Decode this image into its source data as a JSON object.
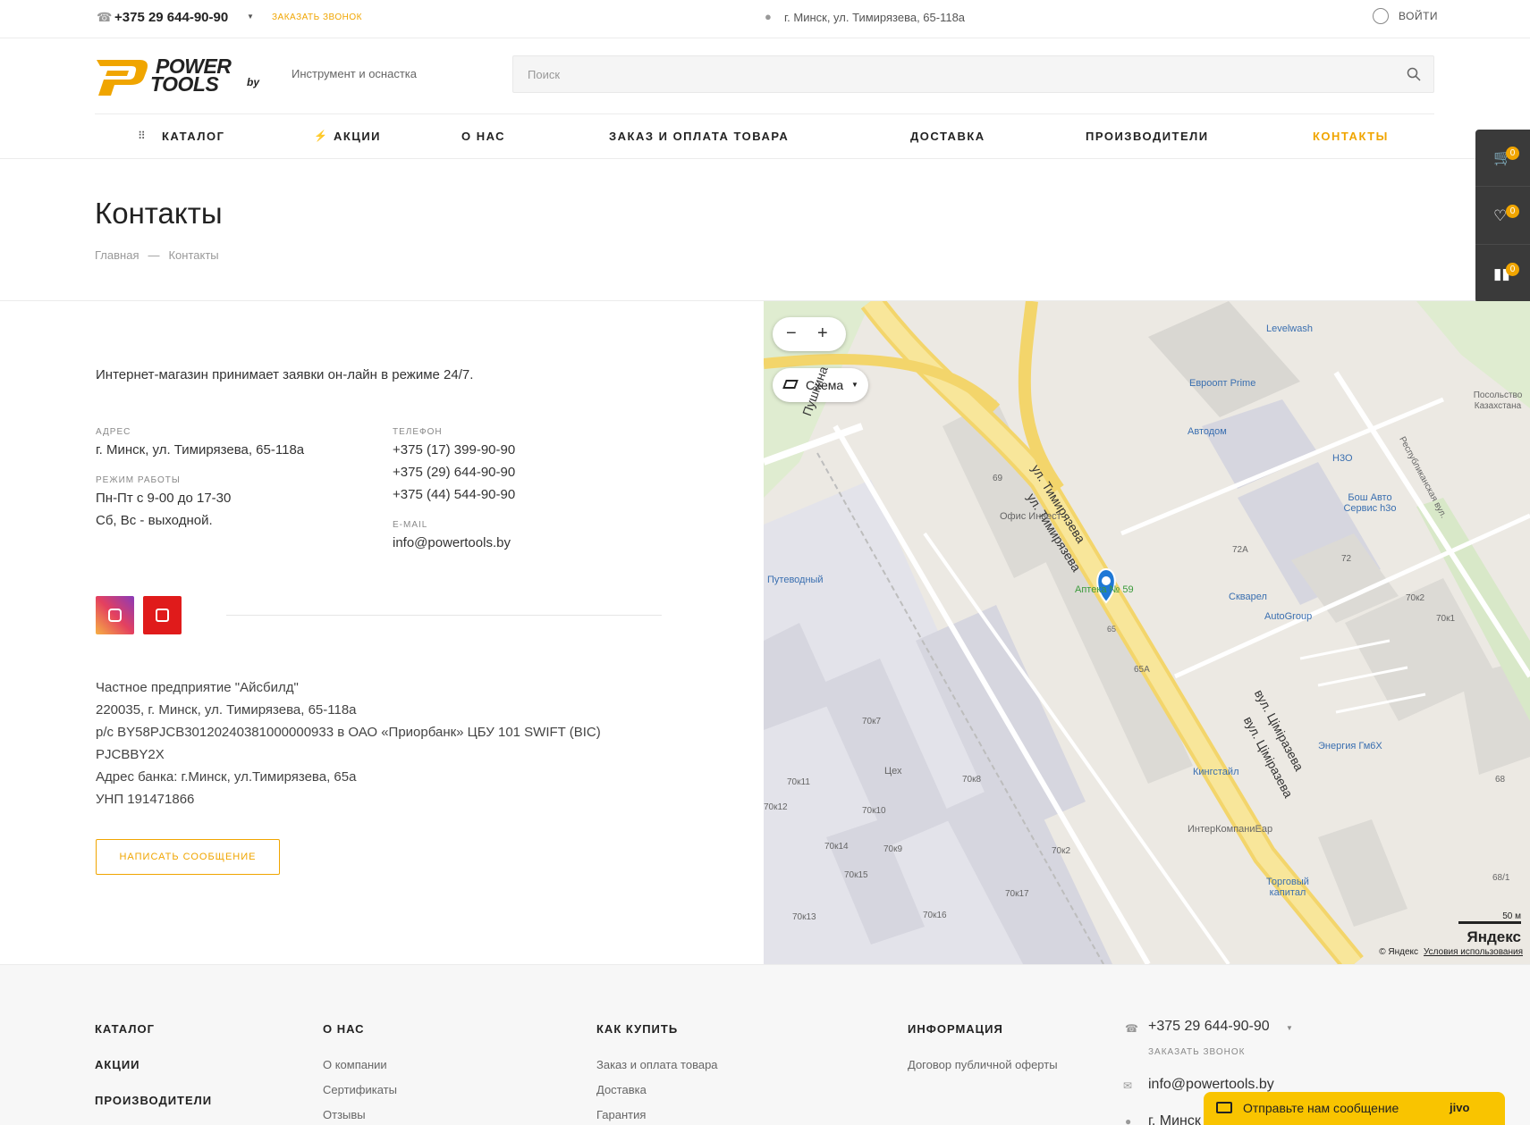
{
  "topbar": {
    "phone": "+375 29 644-90-90",
    "callback": "Заказать звонок",
    "address": "г. Минск, ул. Тимирязева, 65-118а",
    "login": "Войти"
  },
  "header": {
    "logo_text_1": "POWER",
    "logo_text_2": "TOOLS",
    "logo_suffix": "by",
    "tagline": "Инструмент и оснастка",
    "search_placeholder": "Поиск"
  },
  "nav": {
    "items": [
      {
        "label": "Каталог"
      },
      {
        "label": "Акции"
      },
      {
        "label": "О нас"
      },
      {
        "label": "Заказ и оплата товара"
      },
      {
        "label": "Доставка"
      },
      {
        "label": "Производители"
      },
      {
        "label": "Контакты"
      }
    ]
  },
  "page": {
    "title": "Контакты",
    "breadcrumb": [
      "Главная",
      "Контакты"
    ],
    "breadcrumb_sep": "—"
  },
  "side_panel": {
    "cart_count": "0",
    "wishlist_count": "0",
    "compare_count": "0"
  },
  "contacts": {
    "intro": "Интернет-магазин принимает заявки он-лайн в режиме 24/7.",
    "address_label": "Адрес",
    "address": "г. Минск, ул. Тимирязева, 65-118а",
    "hours_label": "Режим работы",
    "hours": [
      "Пн-Пт с 9-00 до 17-30",
      "Сб, Вс - выходной."
    ],
    "phone_label": "Телефон",
    "phones": [
      "+375 (17) 399-90-90",
      "+375 (29) 644-90-90",
      "+375 (44) 544-90-90"
    ],
    "email_label": "E-mail",
    "email": "info@powertools.by",
    "legal": [
      "Частное предприятие \"Айсбилд\"",
      "220035, г. Минск, ул. Тимирязева, 65-118а",
      "р/с BY58PJCB30120240381000000933 в ОАО «Приорбанк» ЦБУ 101 SWIFT (BIC)",
      "PJCBBY2X",
      "Адрес банка: г.Минск, ул.Тимирязева, 65а",
      "УНП 191471866"
    ],
    "message_button": "Написать сообщение"
  },
  "map": {
    "zoom_out": "−",
    "zoom_in": "+",
    "scheme": "Схема",
    "streets": [
      "ул. Тимирязева",
      "ул. Тимирязева",
      "вул. Цiмiразева",
      "вул. Цiмiразева",
      "Пушкина"
    ],
    "pois": [
      "Levelwash",
      "Евроопт Prime",
      "Автодом",
      "H3O",
      "Бош Авто Сервис h3o",
      "Скварел",
      "AutoGroup",
      "Путеводный",
      "Офис Инвест",
      "Энергия Гм6Х",
      "Кингстайл",
      "ИнтерКомпаниЕар",
      "Торговый капитал",
      "Посольство Казахстана",
      "Цех"
    ],
    "pharmacy": "Аптека № 59",
    "buildings": [
      "69",
      "72А",
      "72",
      "70к2",
      "70к1",
      "65А",
      "70к7",
      "70к8",
      "70к11",
      "70к12",
      "70к10",
      "70к14",
      "70к9",
      "70к15",
      "70к2",
      "70к17",
      "70к16",
      "70к13",
      "68",
      "68/1",
      "65"
    ],
    "side_street": "Республиканская вул.",
    "scale": "50 м",
    "logo": "Яндекс",
    "copyright": "© Яндекс",
    "terms": "Условия использования"
  },
  "footer": {
    "col1": [
      "Каталог",
      "Акции",
      "Производители"
    ],
    "col2_head": "О нас",
    "col2": [
      "О компании",
      "Сертификаты",
      "Отзывы"
    ],
    "col3_head": "Как купить",
    "col3": [
      "Заказ и оплата товара",
      "Доставка",
      "Гарантия"
    ],
    "col4_head": "Информация",
    "col4": [
      "Договор публичной оферты"
    ],
    "phone": "+375 29 644-90-90",
    "callback": "Заказать звонок",
    "email": "info@powertools.by",
    "address_partial": "г. Минск"
  },
  "jivo": {
    "text": "Отправьте нам сообщение",
    "brand": "jivo"
  }
}
